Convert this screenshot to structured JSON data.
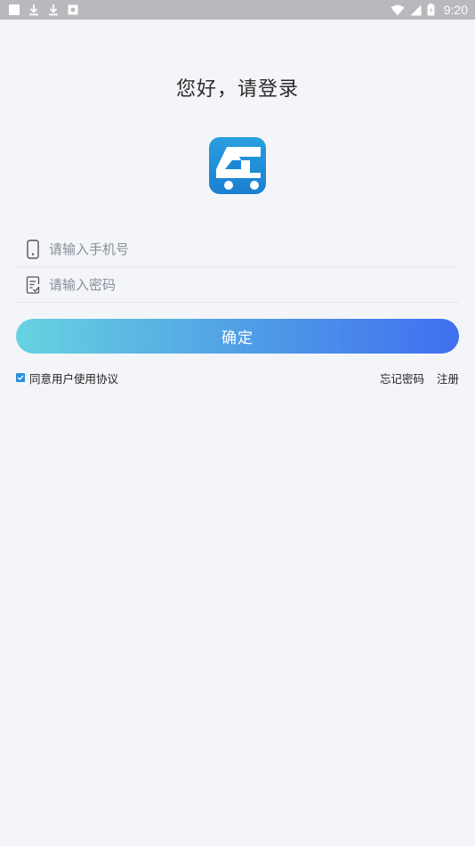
{
  "status_bar": {
    "time": "9:20",
    "left_icons": [
      "square-icon",
      "download-icon",
      "download-icon",
      "image-icon"
    ],
    "right_icons": [
      "wifi-icon",
      "signal-icon",
      "battery-icon"
    ]
  },
  "header": {
    "title": "您好，请登录"
  },
  "form": {
    "phone_placeholder": "请输入手机号",
    "password_placeholder": "请输入密码",
    "submit_label": "确定"
  },
  "footer": {
    "agree_label": "同意用户使用协议",
    "agree_checked": true,
    "forgot_label": "忘记密码",
    "register_label": "注册"
  },
  "colors": {
    "background": "#f4f5f9",
    "accent": "#2a8fe0",
    "button_gradient_start": "#67d3e0",
    "button_gradient_end": "#3f6ff0"
  }
}
